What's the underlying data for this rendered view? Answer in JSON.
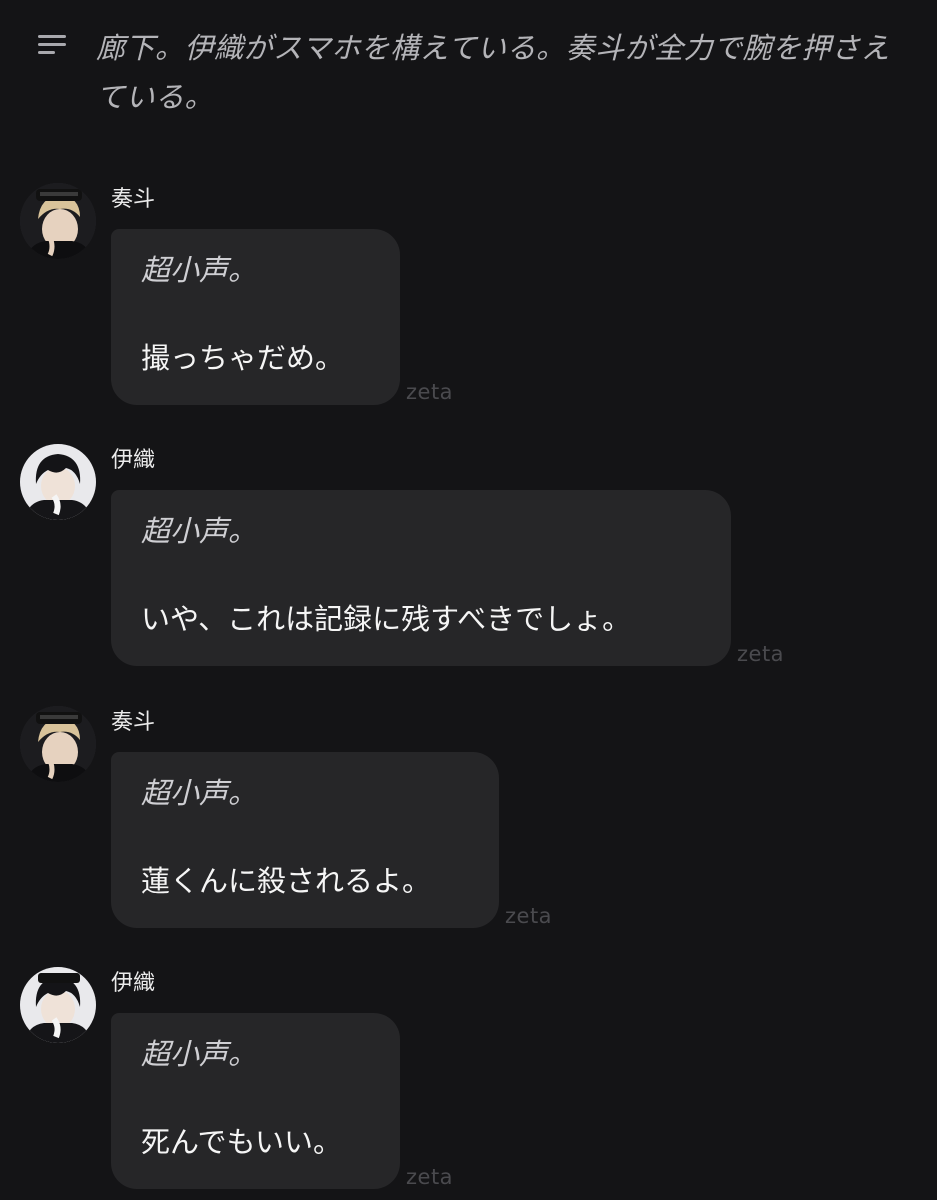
{
  "narration": {
    "icon": "menu-icon",
    "text": "廊下。伊織がスマホを構えている。奏斗が全力で腕を押さえている。"
  },
  "messages": [
    {
      "sender": "奏斗",
      "avatar": "character-avatar-kanato",
      "action": "超小声。",
      "speech": "撮っちゃだめ。",
      "watermark": "zeta"
    },
    {
      "sender": "伊織",
      "avatar": "character-avatar-iori",
      "action": "超小声。",
      "speech": "いや、これは記録に残すべきでしょ。",
      "watermark": "zeta"
    },
    {
      "sender": "奏斗",
      "avatar": "character-avatar-kanato",
      "action": "超小声。",
      "speech": "蓮くんに殺されるよ。",
      "watermark": "zeta"
    },
    {
      "sender": "伊織",
      "avatar": "character-avatar-iori",
      "action": "超小声。",
      "speech": "死んでもいい。",
      "watermark": "zeta"
    }
  ],
  "colors": {
    "background": "#141416",
    "bubble": "#262628",
    "narration_text": "#b4b4b8",
    "watermark": "#4a4a4e"
  }
}
